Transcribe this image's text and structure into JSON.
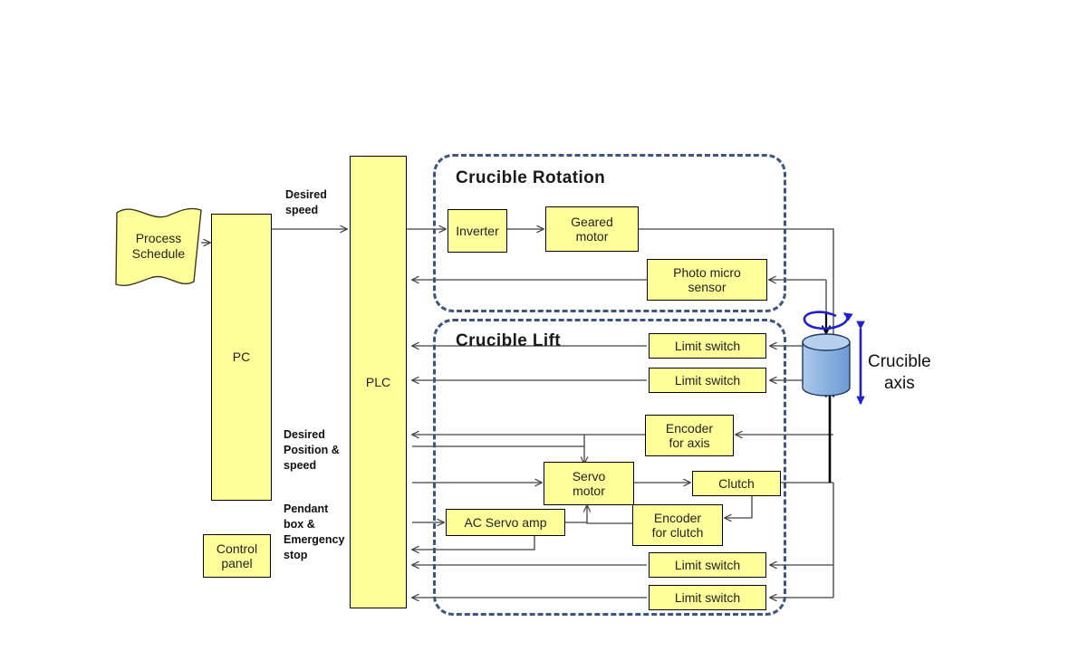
{
  "diagram": {
    "title": "Crucible rotation and lift control block diagram",
    "colors": {
      "block_fill": "#FFFF99",
      "block_border": "#000000",
      "group_border": "#3F5580",
      "crucible_fill": "#8DB4E2",
      "crucible_border": "#1F3864",
      "axis_arrow": "#2020CC",
      "line": "#404040"
    },
    "groups": [
      {
        "id": "rotation",
        "title": "Crucible Rotation"
      },
      {
        "id": "lift",
        "title": "Crucible Lift"
      }
    ],
    "blocks": [
      {
        "id": "process_schedule",
        "label_lines": [
          "Process",
          "Schedule"
        ],
        "shape": "banner"
      },
      {
        "id": "pc",
        "label_lines": [
          "PC"
        ],
        "shape": "rect"
      },
      {
        "id": "plc",
        "label_lines": [
          "PLC"
        ],
        "shape": "rect"
      },
      {
        "id": "control_panel",
        "label_lines": [
          "Control",
          "panel"
        ],
        "shape": "rect"
      },
      {
        "id": "inverter",
        "label_lines": [
          "Inverter"
        ],
        "shape": "rect"
      },
      {
        "id": "geared_motor",
        "label_lines": [
          "Geared",
          "motor"
        ],
        "shape": "rect"
      },
      {
        "id": "photo_micro_sensor",
        "label_lines": [
          "Photo micro",
          "sensor"
        ],
        "shape": "rect"
      },
      {
        "id": "limit_switch_1",
        "label_lines": [
          "Limit switch"
        ],
        "shape": "rect"
      },
      {
        "id": "limit_switch_2",
        "label_lines": [
          "Limit switch"
        ],
        "shape": "rect"
      },
      {
        "id": "encoder_for_axis",
        "label_lines": [
          "Encoder",
          "for axis"
        ],
        "shape": "rect"
      },
      {
        "id": "servo_motor",
        "label_lines": [
          "Servo",
          "motor"
        ],
        "shape": "rect"
      },
      {
        "id": "clutch",
        "label_lines": [
          "Clutch"
        ],
        "shape": "rect"
      },
      {
        "id": "ac_servo_amp",
        "label_lines": [
          "AC Servo amp"
        ],
        "shape": "rect"
      },
      {
        "id": "encoder_for_clutch",
        "label_lines": [
          "Encoder",
          "for clutch"
        ],
        "shape": "rect"
      },
      {
        "id": "limit_switch_3",
        "label_lines": [
          "Limit switch"
        ],
        "shape": "rect"
      },
      {
        "id": "limit_switch_4",
        "label_lines": [
          "Limit switch"
        ],
        "shape": "rect"
      },
      {
        "id": "crucible",
        "label_lines": [
          "Crucible",
          "axis"
        ],
        "shape": "cylinder"
      }
    ],
    "edge_labels": [
      {
        "id": "desired_speed",
        "text": "Desired\nspeed",
        "line1": "Desired",
        "line2": "speed"
      },
      {
        "id": "desired_position_speed",
        "line1": "Desired",
        "line2": "Position  &",
        "line3": "speed"
      },
      {
        "id": "pendant_emergency",
        "line1": "Pendant",
        "line2": "box &",
        "line3": "Emergency",
        "line4": "stop"
      }
    ],
    "labels": {
      "process_schedule_l1": "Process",
      "process_schedule_l2": "Schedule",
      "pc": "PC",
      "plc": "PLC",
      "control_panel_l1": "Control",
      "control_panel_l2": "panel",
      "rotation_group_title": "Crucible Rotation",
      "lift_group_title": "Crucible Lift",
      "inverter": "Inverter",
      "geared_motor_l1": "Geared",
      "geared_motor_l2": "motor",
      "photo_micro_l1": "Photo micro",
      "photo_micro_l2": "sensor",
      "limit_switch": "Limit switch",
      "encoder_axis_l1": "Encoder",
      "encoder_axis_l2": "for axis",
      "servo_motor_l1": "Servo",
      "servo_motor_l2": "motor",
      "clutch": "Clutch",
      "ac_servo_amp": "AC Servo amp",
      "encoder_clutch_l1": "Encoder",
      "encoder_clutch_l2": "for clutch",
      "crucible_axis_l1": "Crucible",
      "crucible_axis_l2": "axis",
      "desired_speed_l1": "Desired",
      "desired_speed_l2": "speed",
      "desired_pos_l1": "Desired",
      "desired_pos_l2": "Position  &",
      "desired_pos_l3": "speed",
      "pendant_l1": "Pendant",
      "pendant_l2": "box &",
      "pendant_l3": "Emergency",
      "pendant_l4": "stop"
    }
  }
}
